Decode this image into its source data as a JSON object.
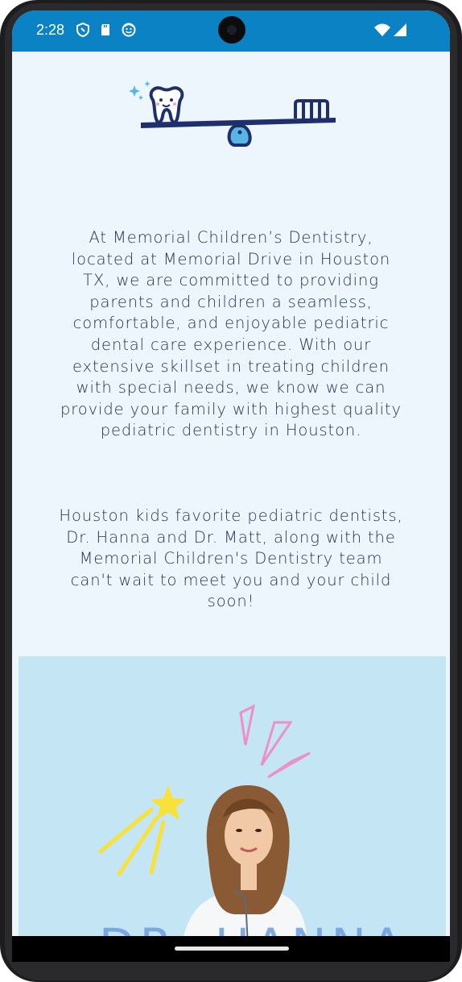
{
  "status_bar": {
    "time": "2:28",
    "icons": [
      "shield-icon",
      "sd-card-icon",
      "face-icon"
    ],
    "right_icons": [
      "wifi-icon",
      "cell-signal-icon"
    ]
  },
  "logo": {
    "name": "tooth-toothbrush-seesaw-logo",
    "colors": {
      "navy": "#1f2f6b",
      "light_blue": "#57b6e6"
    }
  },
  "intro": {
    "paragraph1": "At Memorial Children’s Dentistry, located at Memorial Drive in Houston TX, we are committed to providing parents and children a seamless, comfortable, and enjoyable pediatric dental care experience. With our extensive skillset in treating children with special needs, we know we can provide your family with highest quality pediatric dentistry in Houston.",
    "paragraph2": "Houston kids favorite pediatric dentists, Dr. Hanna and Dr. Matt, along with the Memorial Children's Dentistry team can't wait to meet you and your child soon!"
  },
  "photo": {
    "background": "#c4e5f3",
    "partial_caption": "DR. HANNA",
    "decorations": [
      "shooting-star-icon",
      "sparkle-lines-icon"
    ]
  },
  "colors": {
    "status_bar": "#0a82c4",
    "page_background": "#eef6fd",
    "text": "#1f2f55"
  }
}
